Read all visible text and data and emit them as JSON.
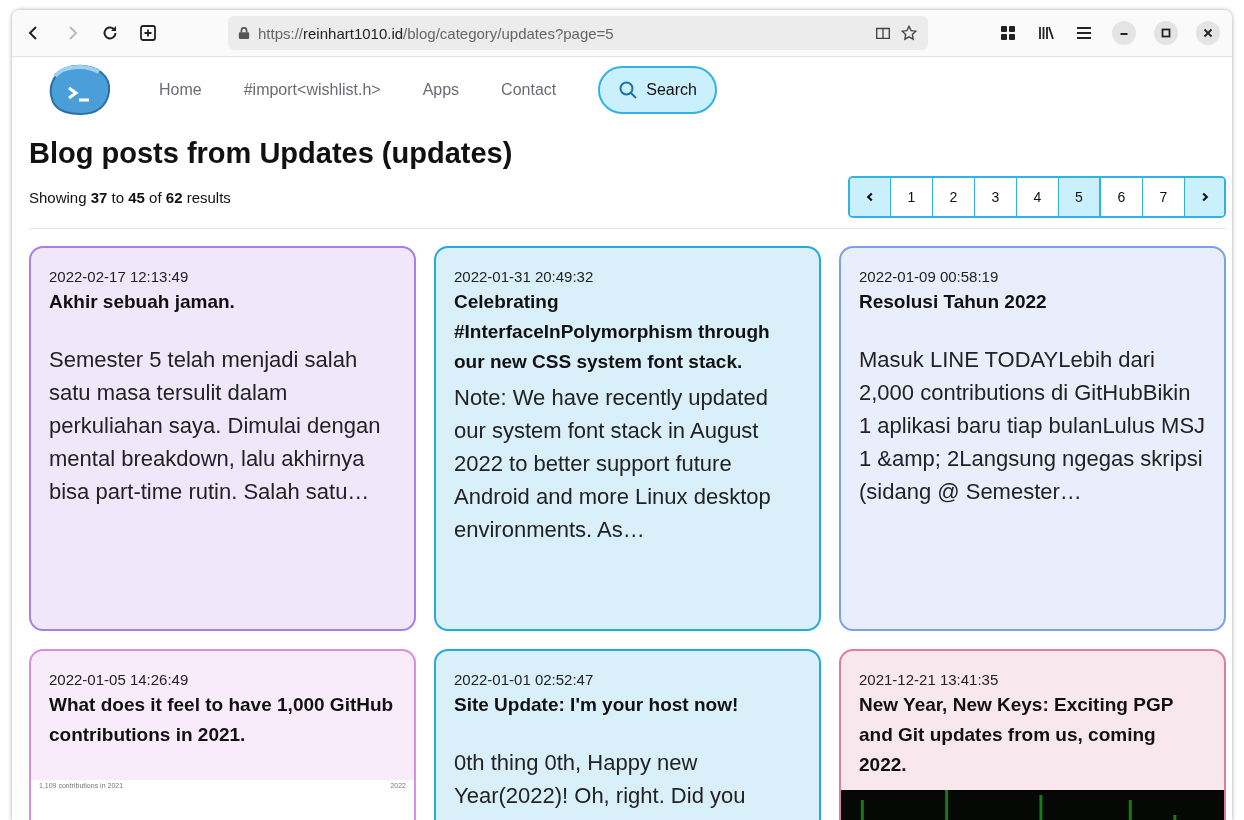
{
  "browser": {
    "url_scheme": "https://",
    "url_host": "reinhart1010.id",
    "url_path": "/blog/category/updates?page=5",
    "forward_disabled": true
  },
  "nav": {
    "items": [
      {
        "label": "Home"
      },
      {
        "label": "#import<wishlist.h>"
      },
      {
        "label": "Apps"
      },
      {
        "label": "Contact"
      }
    ],
    "search_label": "Search"
  },
  "heading": "Blog posts from Updates (updates)",
  "summary": "Showing **37** to **45** of **62** results",
  "pagination": [
    {
      "label": "1",
      "selected": false
    },
    {
      "label": "2",
      "selected": false
    },
    {
      "label": "3",
      "selected": false
    },
    {
      "label": "4",
      "selected": false
    },
    {
      "label": "5",
      "selected": true
    },
    {
      "label": "6",
      "selected": false
    },
    {
      "label": "7",
      "selected": false
    }
  ],
  "posts": [
    {
      "date": "2022-02-17 12:13:49",
      "title": "Akhir sebuah jaman.",
      "excerpt": "Semester 5 telah menjadi salah satu masa tersulit dalam perkuliahan saya. Dimulai dengan mental breakdown, lalu akhirnya bisa part-time rutin. Salah satu…",
      "color": "#a97fe3"
    },
    {
      "date": "2022-01-31 20:49:32",
      "title": "Celebrating #InterfaceInPolymorphism through our new CSS system font stack.",
      "excerpt": "Note: We have recently updated our system font stack in August 2022 to better support future Android and more Linux desktop environments. As…",
      "color": "#2aa8dc"
    },
    {
      "date": "2022-01-09 00:58:19",
      "title": "Resolusi Tahun 2022",
      "excerpt": "Masuk LINE TODAYLebih dari 2,000 contributions di GitHubBikin 1 aplikasi baru tiap bulanLulus MSJ 1 &amp; 2Langsung ngegas skripsi (sidang @ Semester…",
      "color": "#7ea0e8"
    },
    {
      "date": "2022-01-05 14:26:49",
      "title": "What does it feel to have 1,000 GitHub contributions in 2021.",
      "media": {
        "kind": "screenshot",
        "caption": "1,109 contributions in 2021",
        "year": "2022"
      },
      "color": "#d98ee2"
    },
    {
      "date": "2022-01-01 02:52:47",
      "title": "Site Update: I'm your host now!",
      "excerpt": "0th thing 0th, Happy new Year(2022)! Oh, right. Did you",
      "color": "#2aa8dc"
    },
    {
      "date": "2021-12-21 13:41:35",
      "title": "New Year, New Keys: Exciting PGP and Git updates from us, coming 2022.",
      "color": "#e07ca3"
    }
  ]
}
